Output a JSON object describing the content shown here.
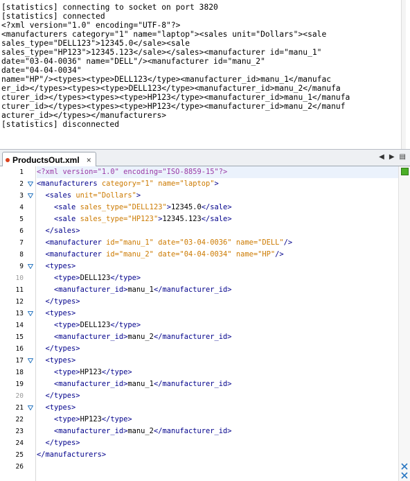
{
  "console": {
    "lines": [
      "[statistics] connecting to socket on port 3820",
      "[statistics] connected",
      "<?xml version=\"1.0\" encoding=\"UTF-8\"?>",
      "<manufacturers category=\"1\" name=\"laptop\"><sales unit=\"Dollars\"><sale",
      "sales_type=\"DELL123\">12345.0</sale><sale",
      "sales_type=\"HP123\">12345.123</sale></sales><manufacturer id=\"manu_1\"",
      "date=\"03-04-0036\" name=\"DELL\"/><manufacturer id=\"manu_2\"",
      "date=\"04-04-0034\"",
      "name=\"HP\"/><types><type>DELL123</type><manufacturer_id>manu_1</manufac",
      "er_id></types><types><type>DELL123</type><manufacturer_id>manu_2</manufa",
      "cturer_id></types><types><type>HP123</type><manufacturer_id>manu_1</manufa",
      "cturer_id></types><types><type>HP123</type><manufacturer_id>manu_2</manuf",
      "acturer_id></types></manufacturers>",
      "[statistics] disconnected"
    ]
  },
  "tab": {
    "title": "ProductsOut.xml",
    "close_label": "×"
  },
  "editor": {
    "lines": [
      {
        "n": "1",
        "fold": false,
        "gray": false,
        "hl": true,
        "parts": [
          [
            "decl",
            "<?xml version=\"1.0\" encoding=\"ISO-8859-15\"?>"
          ]
        ]
      },
      {
        "n": "2",
        "fold": true,
        "gray": false,
        "hl": false,
        "parts": [
          [
            "tag",
            "<manufacturers "
          ],
          [
            "attr",
            "category="
          ],
          [
            "val",
            "\"1\""
          ],
          [
            "tag",
            " "
          ],
          [
            "attr",
            "name="
          ],
          [
            "val",
            "\"laptop\""
          ],
          [
            "tag",
            ">"
          ]
        ]
      },
      {
        "n": "3",
        "fold": true,
        "gray": false,
        "hl": false,
        "parts": [
          [
            "txt",
            "  "
          ],
          [
            "tag",
            "<sales "
          ],
          [
            "attr",
            "unit="
          ],
          [
            "val",
            "\"Dollars\""
          ],
          [
            "tag",
            ">"
          ]
        ]
      },
      {
        "n": "4",
        "fold": false,
        "gray": false,
        "hl": false,
        "parts": [
          [
            "txt",
            "    "
          ],
          [
            "tag",
            "<sale "
          ],
          [
            "attr",
            "sales_type="
          ],
          [
            "val",
            "\"DELL123\""
          ],
          [
            "tag",
            ">"
          ],
          [
            "txt",
            "12345.0"
          ],
          [
            "tag",
            "</sale>"
          ]
        ]
      },
      {
        "n": "5",
        "fold": false,
        "gray": false,
        "hl": false,
        "parts": [
          [
            "txt",
            "    "
          ],
          [
            "tag",
            "<sale "
          ],
          [
            "attr",
            "sales_type="
          ],
          [
            "val",
            "\"HP123\""
          ],
          [
            "tag",
            ">"
          ],
          [
            "txt",
            "12345.123"
          ],
          [
            "tag",
            "</sale>"
          ]
        ]
      },
      {
        "n": "6",
        "fold": false,
        "gray": false,
        "hl": false,
        "parts": [
          [
            "txt",
            "  "
          ],
          [
            "tag",
            "</sales>"
          ]
        ]
      },
      {
        "n": "7",
        "fold": false,
        "gray": false,
        "hl": false,
        "parts": [
          [
            "txt",
            "  "
          ],
          [
            "tag",
            "<manufacturer "
          ],
          [
            "attr",
            "id="
          ],
          [
            "val",
            "\"manu_1\""
          ],
          [
            "tag",
            " "
          ],
          [
            "attr",
            "date="
          ],
          [
            "val",
            "\"03-04-0036\""
          ],
          [
            "tag",
            " "
          ],
          [
            "attr",
            "name="
          ],
          [
            "val",
            "\"DELL\""
          ],
          [
            "tag",
            "/>"
          ]
        ]
      },
      {
        "n": "8",
        "fold": false,
        "gray": false,
        "hl": false,
        "parts": [
          [
            "txt",
            "  "
          ],
          [
            "tag",
            "<manufacturer "
          ],
          [
            "attr",
            "id="
          ],
          [
            "val",
            "\"manu_2\""
          ],
          [
            "tag",
            " "
          ],
          [
            "attr",
            "date="
          ],
          [
            "val",
            "\"04-04-0034\""
          ],
          [
            "tag",
            " "
          ],
          [
            "attr",
            "name="
          ],
          [
            "val",
            "\"HP\""
          ],
          [
            "tag",
            "/>"
          ]
        ]
      },
      {
        "n": "9",
        "fold": true,
        "gray": false,
        "hl": false,
        "parts": [
          [
            "txt",
            "  "
          ],
          [
            "tag",
            "<types>"
          ]
        ]
      },
      {
        "n": "10",
        "fold": false,
        "gray": true,
        "hl": false,
        "parts": [
          [
            "txt",
            "    "
          ],
          [
            "tag",
            "<type>"
          ],
          [
            "txt",
            "DELL123"
          ],
          [
            "tag",
            "</type>"
          ]
        ]
      },
      {
        "n": "11",
        "fold": false,
        "gray": false,
        "hl": false,
        "parts": [
          [
            "txt",
            "    "
          ],
          [
            "tag",
            "<manufacturer_id>"
          ],
          [
            "txt",
            "manu_1"
          ],
          [
            "tag",
            "</manufacturer_id>"
          ]
        ]
      },
      {
        "n": "12",
        "fold": false,
        "gray": false,
        "hl": false,
        "parts": [
          [
            "txt",
            "  "
          ],
          [
            "tag",
            "</types>"
          ]
        ]
      },
      {
        "n": "13",
        "fold": true,
        "gray": false,
        "hl": false,
        "parts": [
          [
            "txt",
            "  "
          ],
          [
            "tag",
            "<types>"
          ]
        ]
      },
      {
        "n": "14",
        "fold": false,
        "gray": false,
        "hl": false,
        "parts": [
          [
            "txt",
            "    "
          ],
          [
            "tag",
            "<type>"
          ],
          [
            "txt",
            "DELL123"
          ],
          [
            "tag",
            "</type>"
          ]
        ]
      },
      {
        "n": "15",
        "fold": false,
        "gray": false,
        "hl": false,
        "parts": [
          [
            "txt",
            "    "
          ],
          [
            "tag",
            "<manufacturer_id>"
          ],
          [
            "txt",
            "manu_2"
          ],
          [
            "tag",
            "</manufacturer_id>"
          ]
        ]
      },
      {
        "n": "16",
        "fold": false,
        "gray": false,
        "hl": false,
        "parts": [
          [
            "txt",
            "  "
          ],
          [
            "tag",
            "</types>"
          ]
        ]
      },
      {
        "n": "17",
        "fold": true,
        "gray": false,
        "hl": false,
        "parts": [
          [
            "txt",
            "  "
          ],
          [
            "tag",
            "<types>"
          ]
        ]
      },
      {
        "n": "18",
        "fold": false,
        "gray": false,
        "hl": false,
        "parts": [
          [
            "txt",
            "    "
          ],
          [
            "tag",
            "<type>"
          ],
          [
            "txt",
            "HP123"
          ],
          [
            "tag",
            "</type>"
          ]
        ]
      },
      {
        "n": "19",
        "fold": false,
        "gray": false,
        "hl": false,
        "parts": [
          [
            "txt",
            "    "
          ],
          [
            "tag",
            "<manufacturer_id>"
          ],
          [
            "txt",
            "manu_1"
          ],
          [
            "tag",
            "</manufacturer_id>"
          ]
        ]
      },
      {
        "n": "20",
        "fold": false,
        "gray": true,
        "hl": false,
        "parts": [
          [
            "txt",
            "  "
          ],
          [
            "tag",
            "</types>"
          ]
        ]
      },
      {
        "n": "21",
        "fold": true,
        "gray": false,
        "hl": false,
        "parts": [
          [
            "txt",
            "  "
          ],
          [
            "tag",
            "<types>"
          ]
        ]
      },
      {
        "n": "22",
        "fold": false,
        "gray": false,
        "hl": false,
        "parts": [
          [
            "txt",
            "    "
          ],
          [
            "tag",
            "<type>"
          ],
          [
            "txt",
            "HP123"
          ],
          [
            "tag",
            "</type>"
          ]
        ]
      },
      {
        "n": "23",
        "fold": false,
        "gray": false,
        "hl": false,
        "parts": [
          [
            "txt",
            "    "
          ],
          [
            "tag",
            "<manufacturer_id>"
          ],
          [
            "txt",
            "manu_2"
          ],
          [
            "tag",
            "</manufacturer_id>"
          ]
        ]
      },
      {
        "n": "24",
        "fold": false,
        "gray": false,
        "hl": false,
        "parts": [
          [
            "txt",
            "  "
          ],
          [
            "tag",
            "</types>"
          ]
        ]
      },
      {
        "n": "25",
        "fold": false,
        "gray": false,
        "hl": false,
        "parts": [
          [
            "tag",
            "</manufacturers>"
          ]
        ]
      },
      {
        "n": "26",
        "fold": false,
        "gray": false,
        "hl": false,
        "parts": []
      }
    ]
  },
  "icons": {
    "tab_modified": "modified-dot-icon",
    "nav_left": "nav-left-icon",
    "nav_right": "nav-right-icon",
    "nav_menu": "window-list-icon",
    "fold": "fold-arrow-icon",
    "ok": "no-errors-icon",
    "expand": "expand-icon"
  },
  "colors": {
    "tag": "#00008b",
    "attribute": "#cc7a00",
    "value": "#cc7a00",
    "declaration": "#9a3aa6",
    "current_line": "#ebf2fc",
    "ok_marker": "#4caf28",
    "modified_dot": "#d9411e"
  }
}
